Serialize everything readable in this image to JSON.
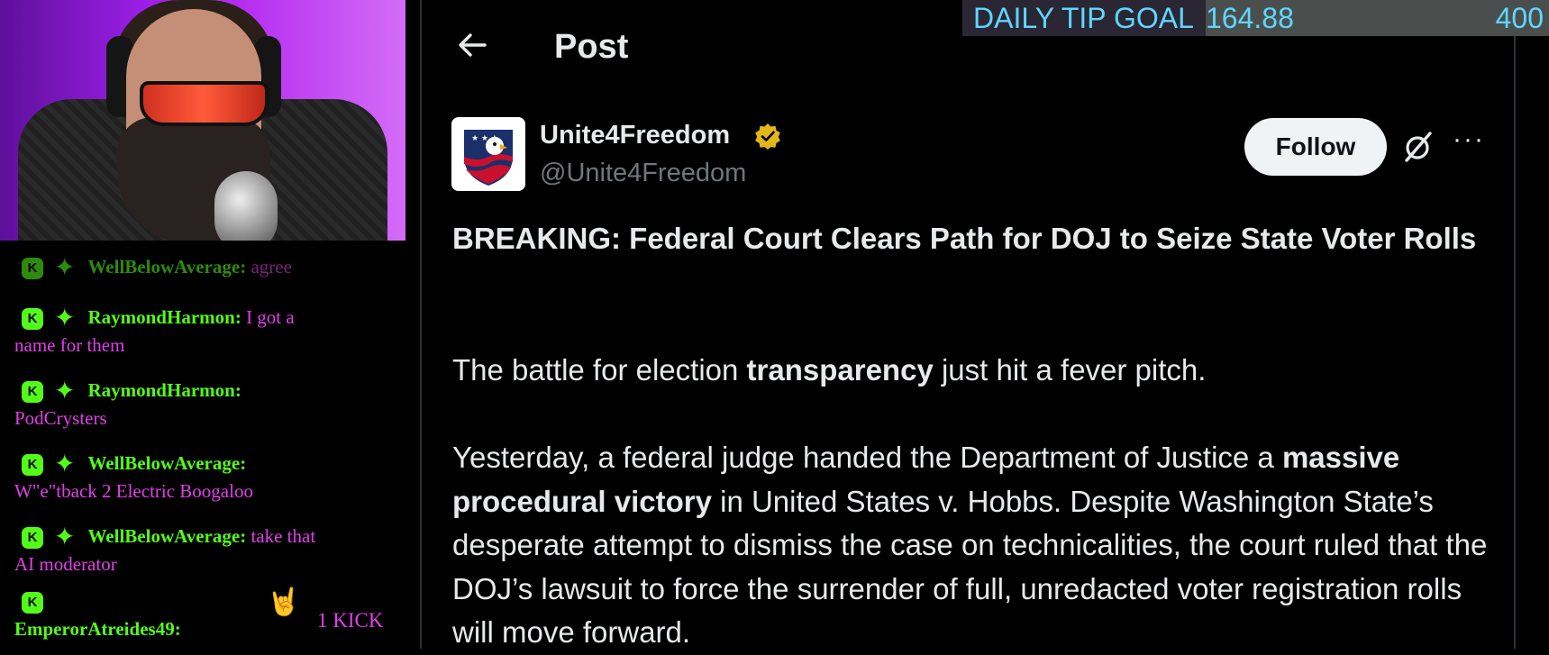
{
  "stream": {
    "chat": [
      {
        "user": "WellBelowAverage:",
        "text": "agree"
      },
      {
        "user": "RaymondHarmon:",
        "text_inline": "I got a",
        "text_cont": "name for them"
      },
      {
        "user": "RaymondHarmon:",
        "text_cont": "PodCrysters"
      },
      {
        "user": "WellBelowAverage:",
        "text_cont": "W\"e\"tback 2 Electric Boogaloo"
      },
      {
        "user": "WellBelowAverage:",
        "text_inline": "take that",
        "text_cont": "AI moderator"
      },
      {
        "user": "EmperorAtreides49:"
      }
    ],
    "kick_event": "1 KICK",
    "badge_letter": "K",
    "colors": {
      "username": "#53fc18",
      "message": "#e23fe8"
    }
  },
  "tip_goal": {
    "label": "DAILY TIP GOAL",
    "current": "164.88",
    "target": "400",
    "progress": 0.4122
  },
  "post": {
    "header_title": "Post",
    "author": {
      "name": "Unite4Freedom",
      "handle": "@Unite4Freedom",
      "verified": true
    },
    "follow_label": "Follow",
    "more_label": "···",
    "headline": "BREAKING: Federal Court Clears Path for DOJ to Seize State Voter Rolls",
    "para1": {
      "a": "The battle for election ",
      "b": "transparency",
      "c": " just hit a fever pitch."
    },
    "para2": {
      "a": "Yesterday, a federal judge handed the Department of Justice a ",
      "b": "massive procedural victory",
      "c": " in United States v. Hobbs. Despite Washington State’s desperate attempt to dismiss the case on technicalities, the court ruled that the DOJ’s lawsuit to force the surrender of full, unredacted voter registration rolls will move forward."
    }
  },
  "icons": [
    "back-arrow-icon",
    "verified-badge-icon",
    "grok-icon",
    "more-icon",
    "kick-badge-icon",
    "sparkle-icon",
    "rock-hand-icon"
  ]
}
